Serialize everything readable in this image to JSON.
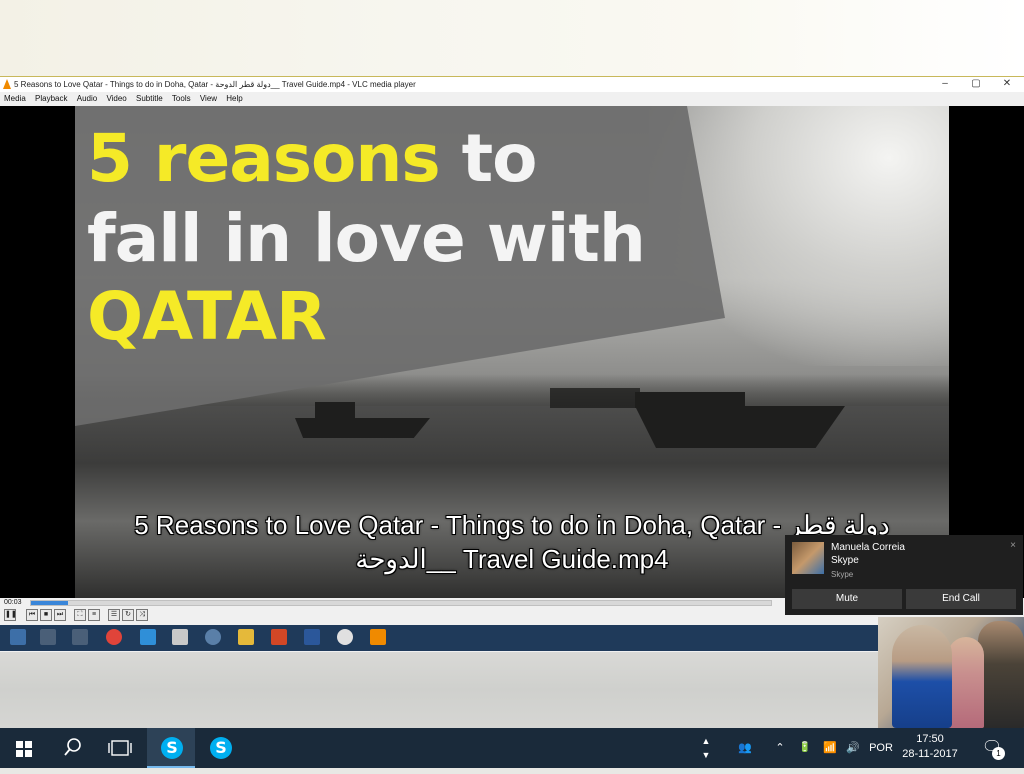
{
  "window": {
    "title": "5 Reasons to Love Qatar - Things to do in Doha, Qatar - دولة قطر الدوحة__ Travel Guide.mp4 - VLC media player",
    "minimize": "–",
    "maximize": "▢",
    "close": "✕"
  },
  "menu": [
    "Media",
    "Playback",
    "Audio",
    "Video",
    "Subtitle",
    "Tools",
    "View",
    "Help"
  ],
  "video": {
    "headline_line1_yellow": "5 reasons",
    "headline_line1_white": " to",
    "headline_line2": "fall in love with",
    "headline_line3": "QATAR",
    "subtitle_line1": "5 Reasons to Love Qatar - Things to do in Doha, Qatar - دولة قطر",
    "subtitle_line2": "الدوحة__ Travel Guide.mp4"
  },
  "playback": {
    "elapsed": "00:03",
    "progress": 0.05
  },
  "skype_toast": {
    "caller": "Manuela Correia",
    "app": "Skype",
    "source": "Skype",
    "close": "×",
    "mute_label": "Mute",
    "end_call_label": "End Call"
  },
  "taskbar": {
    "language": "POR",
    "time": "17:50",
    "date": "28-11-2017",
    "notifications_count": "1"
  },
  "colors": {
    "headline_yellow": "#f5ea27",
    "skype_blue": "#00aff0",
    "vlc_orange": "#f08a00"
  }
}
